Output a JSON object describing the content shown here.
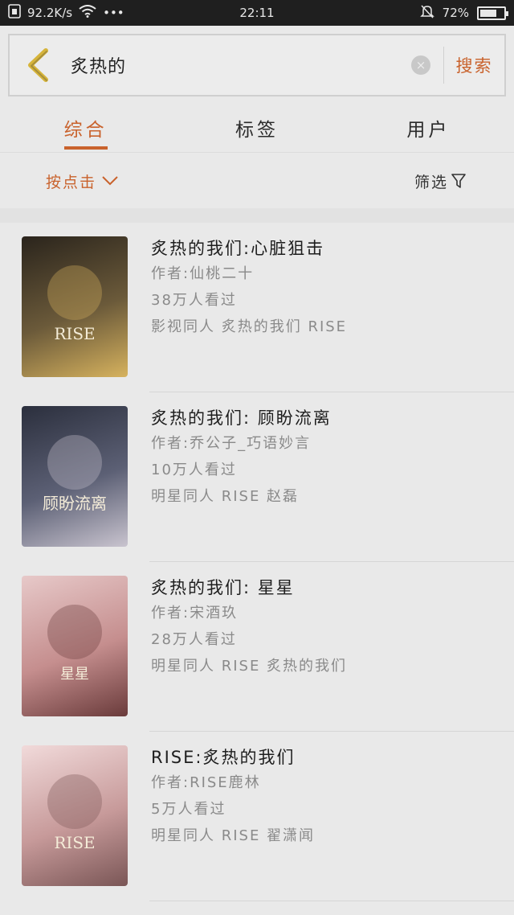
{
  "status": {
    "speed": "92.2K/s",
    "dots": "•••",
    "time": "22:11",
    "battery": "72%",
    "battery_level": 0.72
  },
  "search": {
    "query": "炙热的",
    "clear": "×",
    "button": "搜索"
  },
  "tabs": [
    "综合",
    "标签",
    "用户"
  ],
  "filters": {
    "sort": "按点击",
    "filter": "筛选"
  },
  "books": [
    {
      "title": "炙热的我们:心脏狙击",
      "author": "作者:仙桃二十",
      "views": "38万人看过",
      "tags": "影视同人 炙热的我们 RISE",
      "cover_text": "RISE",
      "cover_colors": [
        "#2a241c",
        "#6b5a3a",
        "#d6b25e"
      ]
    },
    {
      "title": "炙热的我们: 顾盼流离",
      "author": "作者:乔公子_巧语妙言",
      "views": "10万人看过",
      "tags": "明星同人 RISE 赵磊",
      "cover_text": "顾盼流离",
      "cover_colors": [
        "#2b2f3d",
        "#5c6075",
        "#c9c4cf"
      ]
    },
    {
      "title": "炙热的我们: 星星",
      "author": "作者:宋酒玖",
      "views": "28万人看过",
      "tags": "明星同人 RISE 炙热的我们",
      "cover_text": "星星",
      "cover_colors": [
        "#e7c9c9",
        "#c58e8e",
        "#6a3b3b"
      ]
    },
    {
      "title": "RISE:炙热的我们",
      "author": "作者:RISE鹿林",
      "views": "5万人看过",
      "tags": "明星同人 RISE 翟潇闻",
      "cover_text": "RISE",
      "cover_colors": [
        "#f1dada",
        "#c79a9a",
        "#7a5656"
      ]
    }
  ]
}
